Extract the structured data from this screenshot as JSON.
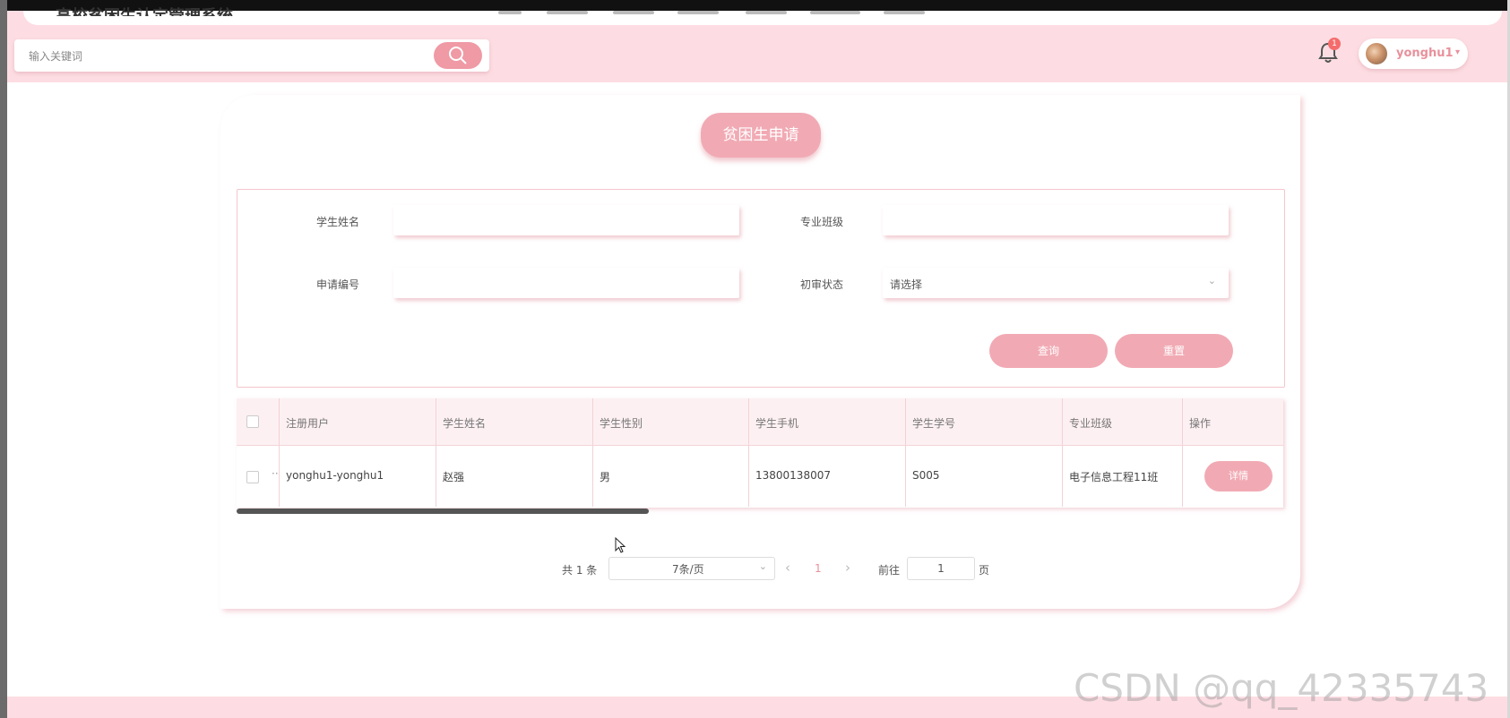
{
  "header": {
    "app_title": "高校贫困生认定管理系统",
    "search_placeholder": "输入关键词",
    "notification_count": "1",
    "username": "yonghu1"
  },
  "page": {
    "title": "贫困生申请"
  },
  "filter": {
    "student_name_label": "学生姓名",
    "major_class_label": "专业班级",
    "application_no_label": "申请编号",
    "review_status_label": "初审状态",
    "review_status_value": "请选择",
    "query_button": "查询",
    "reset_button": "重置"
  },
  "table": {
    "headers": [
      "注册用户",
      "学生姓名",
      "学生性别",
      "学生手机",
      "学生学号",
      "专业班级",
      "操作"
    ],
    "rows": [
      {
        "registered_user": "yonghu1-yonghu1",
        "student_name": "赵强",
        "gender": "男",
        "phone": "13800138007",
        "student_id": "S005",
        "major_class": "电子信息工程11班",
        "action": "详情",
        "ellipsis": "··"
      }
    ]
  },
  "pagination": {
    "total_text": "共 1 条",
    "page_size": "7条/页",
    "current_page": "1",
    "goto_label": "前往",
    "goto_value": "1",
    "page_suffix": "页",
    "prev": "‹",
    "next": "›"
  },
  "watermark": "CSDN @qq_42335743"
}
